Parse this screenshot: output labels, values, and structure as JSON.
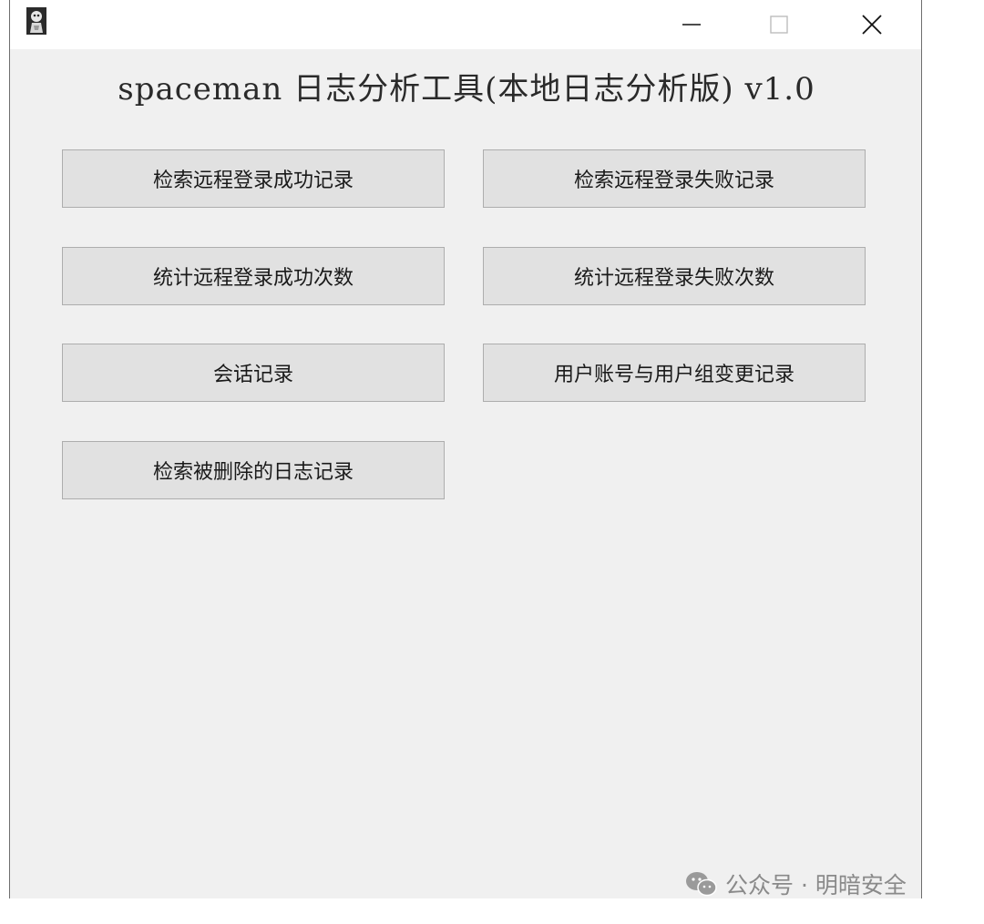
{
  "titlebar": {
    "icon": "app-icon",
    "minimize_symbol": "—",
    "maximize_symbol": "☐",
    "close_symbol": "✕"
  },
  "app": {
    "title": "spaceman 日志分析工具(本地日志分析版) v1.0"
  },
  "buttons": {
    "search_remote_login_success": "检索远程登录成功记录",
    "search_remote_login_failure": "检索远程登录失败记录",
    "count_remote_login_success": "统计远程登录成功次数",
    "count_remote_login_failure": "统计远程登录失败次数",
    "session_records": "会话记录",
    "user_account_group_changes": "用户账号与用户组变更记录",
    "search_deleted_logs": "检索被删除的日志记录"
  },
  "watermark": {
    "icon": "wechat-icon",
    "text": "公众号 · 明暗安全"
  },
  "colors": {
    "window_bg": "#f0f0f0",
    "button_bg": "#e1e1e1",
    "button_border": "#adadad",
    "watermark": "#8a8a8a"
  }
}
